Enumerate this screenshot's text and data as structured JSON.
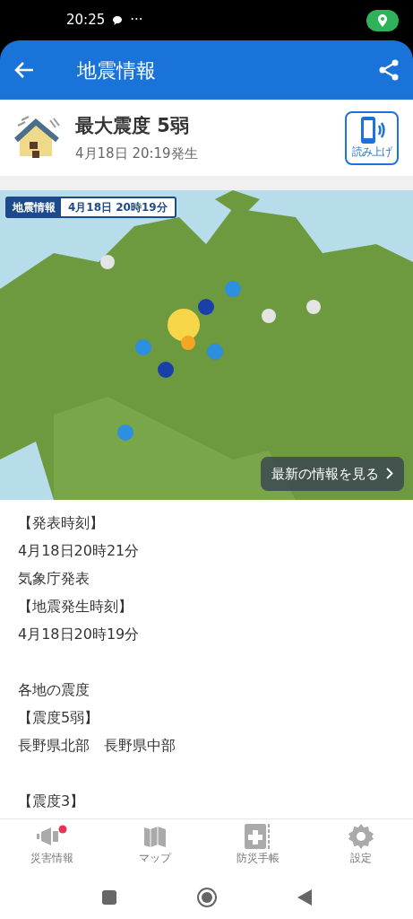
{
  "status_bar": {
    "time": "20:25",
    "dots": "···"
  },
  "app_bar": {
    "title": "地震情報"
  },
  "summary": {
    "headline": "最大震度 5弱",
    "occurred": "4月18日 20:19発生",
    "read_aloud": "読み上げ"
  },
  "map": {
    "kind": "picture",
    "tag_label": "地震情報",
    "tag_time": "4月18日 20時19分",
    "latest_button": "最新の情報を見る"
  },
  "body_sections": [
    {
      "lines": [
        "【発表時刻】",
        "4月18日20時21分",
        "気象庁発表",
        "【地震発生時刻】",
        "4月18日20時19分"
      ]
    },
    {
      "lines": [
        "各地の震度",
        "【震度5弱】",
        "長野県北部　長野県中部"
      ]
    },
    {
      "lines": [
        "【震度3】"
      ]
    }
  ],
  "bottom_nav": [
    {
      "label": "災害情報",
      "kind": "megaphone",
      "notification": true
    },
    {
      "label": "マップ",
      "kind": "map",
      "notification": false
    },
    {
      "label": "防災手帳",
      "kind": "notebook",
      "notification": false
    },
    {
      "label": "設定",
      "kind": "gear",
      "notification": false
    }
  ]
}
